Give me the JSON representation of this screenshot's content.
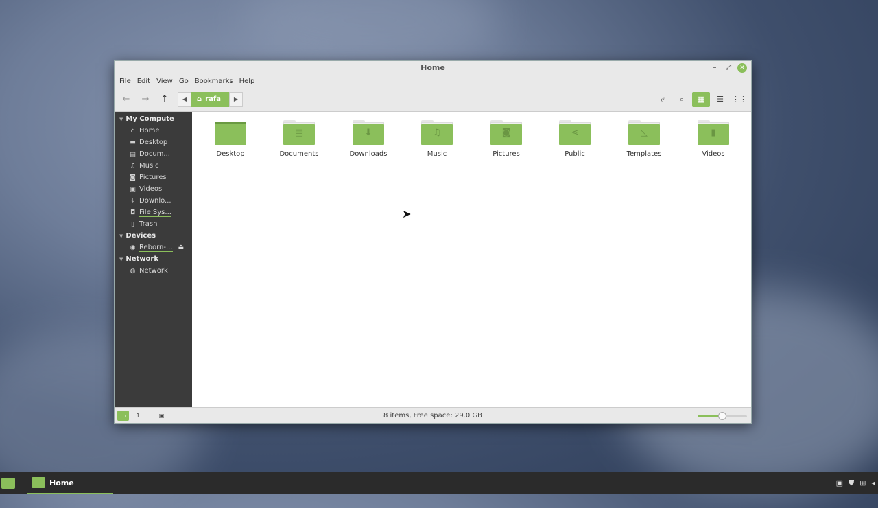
{
  "window": {
    "title": "Home",
    "controls": {
      "minimize": "–",
      "maximize": "⤢",
      "close": "✕"
    }
  },
  "menubar": [
    "File",
    "Edit",
    "View",
    "Go",
    "Bookmarks",
    "Help"
  ],
  "toolbar": {
    "back_icon": "←",
    "forward_icon": "→",
    "up_icon": "↑",
    "breadcrumb": {
      "prev": "◀",
      "label": "rafa",
      "home_icon": "⌂",
      "next": "▶"
    },
    "toggle_location_icon": "⤶",
    "search_icon": "⌕",
    "view_icons": {
      "icon": "▦",
      "list": "☰",
      "compact": "⋮⋮"
    }
  },
  "sidebar": {
    "sections": [
      {
        "title": "My Compute",
        "items": [
          {
            "label": "Home",
            "icon": "⌂"
          },
          {
            "label": "Desktop",
            "icon": "▬"
          },
          {
            "label": "Docum...",
            "icon": "▤"
          },
          {
            "label": "Music",
            "icon": "♫"
          },
          {
            "label": "Pictures",
            "icon": "◙"
          },
          {
            "label": "Videos",
            "icon": "▣"
          },
          {
            "label": "Downlo...",
            "icon": "⤓"
          },
          {
            "label": "File Sys...",
            "icon": "◘"
          },
          {
            "label": "Trash",
            "icon": "▯"
          }
        ]
      },
      {
        "title": "Devices",
        "items": [
          {
            "label": "Reborn-...",
            "icon": "◉",
            "eject": "⏏"
          }
        ]
      },
      {
        "title": "Network",
        "items": [
          {
            "label": "Network",
            "icon": "◍"
          }
        ]
      }
    ]
  },
  "files": [
    {
      "label": "Desktop",
      "symbol": ""
    },
    {
      "label": "Documents",
      "symbol": "▤"
    },
    {
      "label": "Downloads",
      "symbol": "⬇"
    },
    {
      "label": "Music",
      "symbol": "♫"
    },
    {
      "label": "Pictures",
      "symbol": "◙"
    },
    {
      "label": "Public",
      "symbol": "⋖"
    },
    {
      "label": "Templates",
      "symbol": "◺"
    },
    {
      "label": "Videos",
      "symbol": "▮"
    }
  ],
  "statusbar": {
    "text": "8 items, Free space: 29.0 GB",
    "btn_places": "▭",
    "btn_tree": "1:",
    "btn_toggle": "▣",
    "zoom_level": 0.5
  },
  "taskbar": {
    "task_label": "Home",
    "tray": [
      "▣",
      "⛊",
      "⊞",
      "◂"
    ]
  },
  "colors": {
    "accent": "#8bbf5b",
    "sidebar_bg": "#3b3b3b"
  }
}
